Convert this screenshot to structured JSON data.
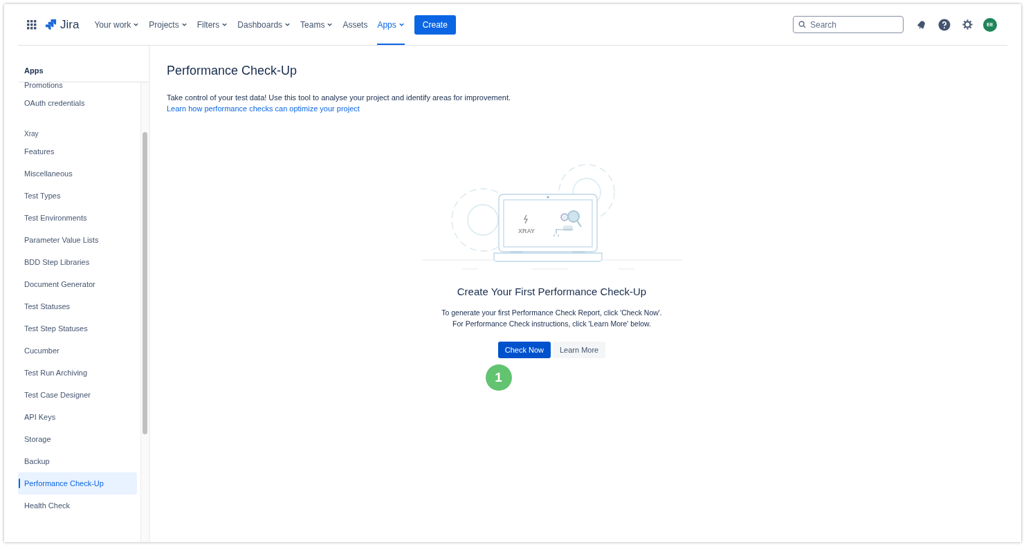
{
  "nav": {
    "product": "Jira",
    "items": [
      {
        "label": "Your work",
        "dropdown": true,
        "selected": false
      },
      {
        "label": "Projects",
        "dropdown": true,
        "selected": false
      },
      {
        "label": "Filters",
        "dropdown": true,
        "selected": false
      },
      {
        "label": "Dashboards",
        "dropdown": true,
        "selected": false
      },
      {
        "label": "Teams",
        "dropdown": true,
        "selected": false
      },
      {
        "label": "Assets",
        "dropdown": false,
        "selected": false
      },
      {
        "label": "Apps",
        "dropdown": true,
        "selected": true
      }
    ],
    "create": "Create",
    "search": {
      "placeholder": "Search"
    },
    "avatar": "EE"
  },
  "sidebar": {
    "title": "Apps",
    "items": [
      {
        "kind": "item",
        "label": "Promotions",
        "selected": false
      },
      {
        "kind": "item",
        "label": "OAuth credentials",
        "selected": false
      },
      {
        "kind": "section",
        "label": "Xray"
      },
      {
        "kind": "item",
        "label": "Features",
        "selected": false
      },
      {
        "kind": "item",
        "label": "Miscellaneous",
        "selected": false
      },
      {
        "kind": "item",
        "label": "Test Types",
        "selected": false
      },
      {
        "kind": "item",
        "label": "Test Environments",
        "selected": false
      },
      {
        "kind": "item",
        "label": "Parameter Value Lists",
        "selected": false
      },
      {
        "kind": "item",
        "label": "BDD Step Libraries",
        "selected": false
      },
      {
        "kind": "item",
        "label": "Document Generator",
        "selected": false
      },
      {
        "kind": "item",
        "label": "Test Statuses",
        "selected": false
      },
      {
        "kind": "item",
        "label": "Test Step Statuses",
        "selected": false
      },
      {
        "kind": "item",
        "label": "Cucumber",
        "selected": false
      },
      {
        "kind": "item",
        "label": "Test Run Archiving",
        "selected": false
      },
      {
        "kind": "item",
        "label": "Test Case Designer",
        "selected": false
      },
      {
        "kind": "item",
        "label": "API Keys",
        "selected": false
      },
      {
        "kind": "item",
        "label": "Storage",
        "selected": false
      },
      {
        "kind": "item",
        "label": "Backup",
        "selected": false
      },
      {
        "kind": "item",
        "label": "Performance Check-Up",
        "selected": true
      },
      {
        "kind": "item",
        "label": "Health Check",
        "selected": false
      }
    ]
  },
  "page": {
    "title": "Performance Check-Up",
    "intro": "Take control of your test data! Use this tool to analyse your project and identify areas for improvement.",
    "intro_link": "Learn how performance checks can optimize your project",
    "illustration": {
      "label": "XRAY"
    },
    "empty_title": "Create Your First Performance Check-Up",
    "empty_lines": [
      "To generate your first Performance Check Report, click 'Check Now'.",
      "For Performance Check instructions, click 'Learn More' below."
    ],
    "primary": "Check Now",
    "secondary": "Learn More",
    "step_marker": "1"
  }
}
